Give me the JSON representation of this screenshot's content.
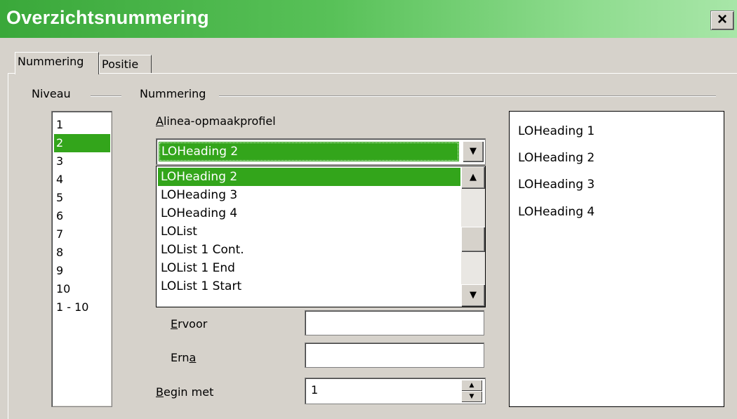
{
  "window": {
    "title": "Overzichtsnummering",
    "close_label": "×",
    "accent_color": "#33a51b"
  },
  "tabs": [
    {
      "label": "Nummering",
      "active": true
    },
    {
      "label": "Positie",
      "active": false
    }
  ],
  "groups": {
    "level_title": "Niveau",
    "numbering_title": "Nummering"
  },
  "levels": {
    "items": [
      "1",
      "2",
      "3",
      "4",
      "5",
      "6",
      "7",
      "8",
      "9",
      "10",
      "1 - 10"
    ],
    "selected": "2"
  },
  "numbering": {
    "paragraph_style_label": "Alinea-opmaakprofiel",
    "paragraph_style_mnemonic": "A",
    "paragraph_style_rest": "linea-opmaakprofiel",
    "paragraph_style_value": "LOHeading 2",
    "dropdown_options": [
      "LOHeading 2",
      "LOHeading 3",
      "LOHeading 4",
      "LOList",
      "LOList 1 Cont.",
      "LOList 1 End",
      "LOList 1 Start"
    ],
    "before_label": "Ervoor",
    "before_mnemonic": "E",
    "before_rest": "rvoor",
    "before_value": "",
    "after_label": "Erna",
    "after_prefix": "Ern",
    "after_mnemonic": "a",
    "after_value": "",
    "start_label": "Begin met",
    "start_mnemonic": "B",
    "start_rest": "egin met",
    "start_value": "1"
  },
  "preview": {
    "lines": [
      "LOHeading 1",
      "LOHeading 2",
      "LOHeading 3",
      "LOHeading 4"
    ]
  },
  "icons": {
    "dropdown_arrow": "▼",
    "scroll_up": "▲",
    "scroll_down": "▼",
    "spin_up": "▲",
    "spin_down": "▼"
  }
}
